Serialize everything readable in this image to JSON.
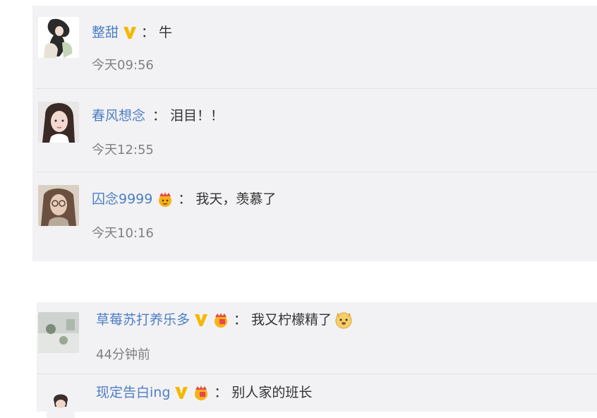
{
  "comments_top": [
    {
      "username": "整甜",
      "colon": "：",
      "content": "牛",
      "time": "今天09:56",
      "badges": [
        "v-badge-icon"
      ]
    },
    {
      "username": "春风想念",
      "colon": "：",
      "content": "泪目！！",
      "time": "今天12:55",
      "badges": []
    },
    {
      "username": "囚念9999",
      "colon": "：",
      "content": "我天，羡慕了",
      "time": "今天10:16",
      "badges": [
        "crown-badge-icon"
      ]
    }
  ],
  "comments_bottom": [
    {
      "username": "草莓苏打养乐多",
      "colon": "：",
      "content": "我又柠檬精了",
      "time": "44分钟前",
      "badges": [
        "v-badge-icon",
        "crown-badge-icon"
      ],
      "emoji": "dog-emoji-icon"
    },
    {
      "username": "现定告白ing",
      "colon": "：",
      "content": "别人家的班长",
      "time": "",
      "badges": [
        "v-badge-icon",
        "crown-badge-icon"
      ]
    }
  ],
  "colors": {
    "username": "#4d7ec3",
    "panel_bg": "#f2f2f5",
    "time": "#808080",
    "v_badge": "#f5b800"
  }
}
